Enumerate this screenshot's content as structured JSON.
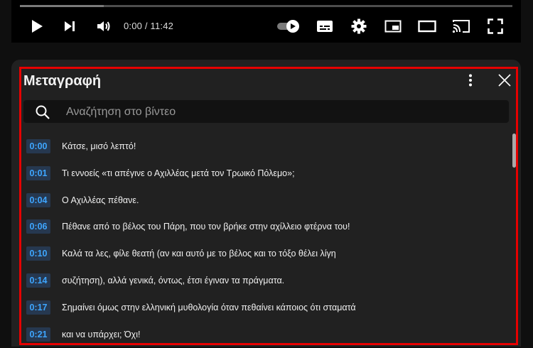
{
  "player": {
    "time_display": "0:00 / 11:42",
    "progress_buffered_fraction": 0.17
  },
  "transcript": {
    "title": "Μεταγραφή",
    "search_placeholder": "Αναζήτηση στο βίντεο",
    "segments": [
      {
        "time": "0:00",
        "text": "Κάτσε, μισό λεπτό!"
      },
      {
        "time": "0:01",
        "text": "Τι εννοείς «τι απέγινε ο Αχιλλέας μετά τον Τρωικό Πόλεμο»;"
      },
      {
        "time": "0:04",
        "text": "Ο Αχιλλέας πέθανε."
      },
      {
        "time": "0:06",
        "text": "Πέθανε από το βέλος του Πάρη, που τον βρήκε στην αχίλλειο φτέρνα του!"
      },
      {
        "time": "0:10",
        "text": "Καλά τα λες, φίλε θεατή (αν και αυτό με το βέλος και το τόξο θέλει λίγη"
      },
      {
        "time": "0:14",
        "text": "συζήτηση), αλλά γενικά, όντως, έτσι έγιναν τα πράγματα."
      },
      {
        "time": "0:17",
        "text": "Σημαίνει όμως στην ελληνική μυθολογία όταν πεθαίνει κάποιος ότι σταματά"
      },
      {
        "time": "0:21",
        "text": "και να υπάρχει; Όχι!"
      }
    ]
  },
  "colors": {
    "accent_highlight": "#e60000",
    "timestamp_text": "#3ea6ff",
    "timestamp_bg": "#263850"
  }
}
